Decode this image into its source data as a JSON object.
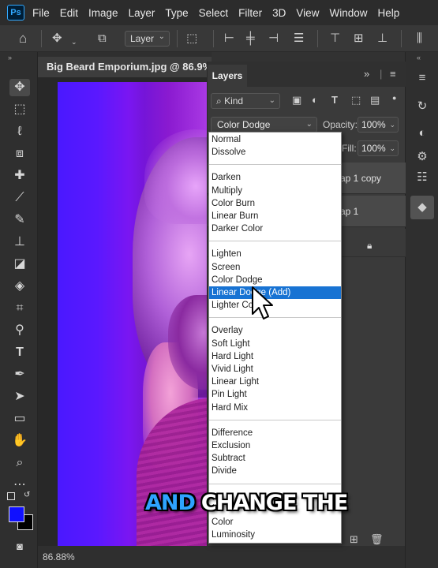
{
  "app": {
    "logo": "Ps"
  },
  "menu": [
    "File",
    "Edit",
    "Image",
    "Layer",
    "Type",
    "Select",
    "Filter",
    "3D",
    "View",
    "Window",
    "Help"
  ],
  "options_bar": {
    "layer_select": "Layer"
  },
  "document": {
    "tab_title": "Big Beard Emporium.jpg @ 86.9% (RG",
    "zoom_status": "86.88%"
  },
  "layers_panel": {
    "tab": "Layers",
    "kind_filter": "Kind",
    "blend_mode": "Color Dodge",
    "opacity_label": "Opacity:",
    "opacity_value": "100%",
    "fill_label": "Fill:",
    "fill_value": "100%",
    "layers": [
      {
        "name_partial": "ap 1 copy"
      },
      {
        "name_partial": "ap 1"
      }
    ]
  },
  "blend_menu": {
    "groups": [
      [
        "Normal",
        "Dissolve"
      ],
      [
        "Darken",
        "Multiply",
        "Color Burn",
        "Linear Burn",
        "Darker Color"
      ],
      [
        "Lighten",
        "Screen",
        "Color Dodge",
        "Linear Dodge (Add)",
        "Lighter Color"
      ],
      [
        "Overlay",
        "Soft Light",
        "Hard Light",
        "Vivid Light",
        "Linear Light",
        "Pin Light",
        "Hard Mix"
      ],
      [
        "Difference",
        "Exclusion",
        "Subtract",
        "Divide"
      ],
      [
        "Color",
        "Luminosity"
      ]
    ],
    "highlighted": "Linear Dodge (Add)"
  },
  "caption": {
    "highlight": "AND",
    "rest": "CHANGE THE"
  },
  "colors": {
    "highlight_blue": "#1873d3",
    "caption_blue": "#2ea3ff",
    "foreground_swatch": "#1010ff",
    "background_swatch": "#000000"
  },
  "icons": {
    "toolbar": [
      "move-icon",
      "marquee-icon",
      "lasso-icon",
      "object-select-icon",
      "healing-icon",
      "eyedropper-icon",
      "brush-icon",
      "stamp-icon",
      "eraser-icon",
      "bucket-icon",
      "crop-icon",
      "dodge-icon",
      "type-icon",
      "pen-icon",
      "path-select-icon",
      "rectangle-icon",
      "hand-icon",
      "zoom-icon",
      "more-icon"
    ]
  }
}
